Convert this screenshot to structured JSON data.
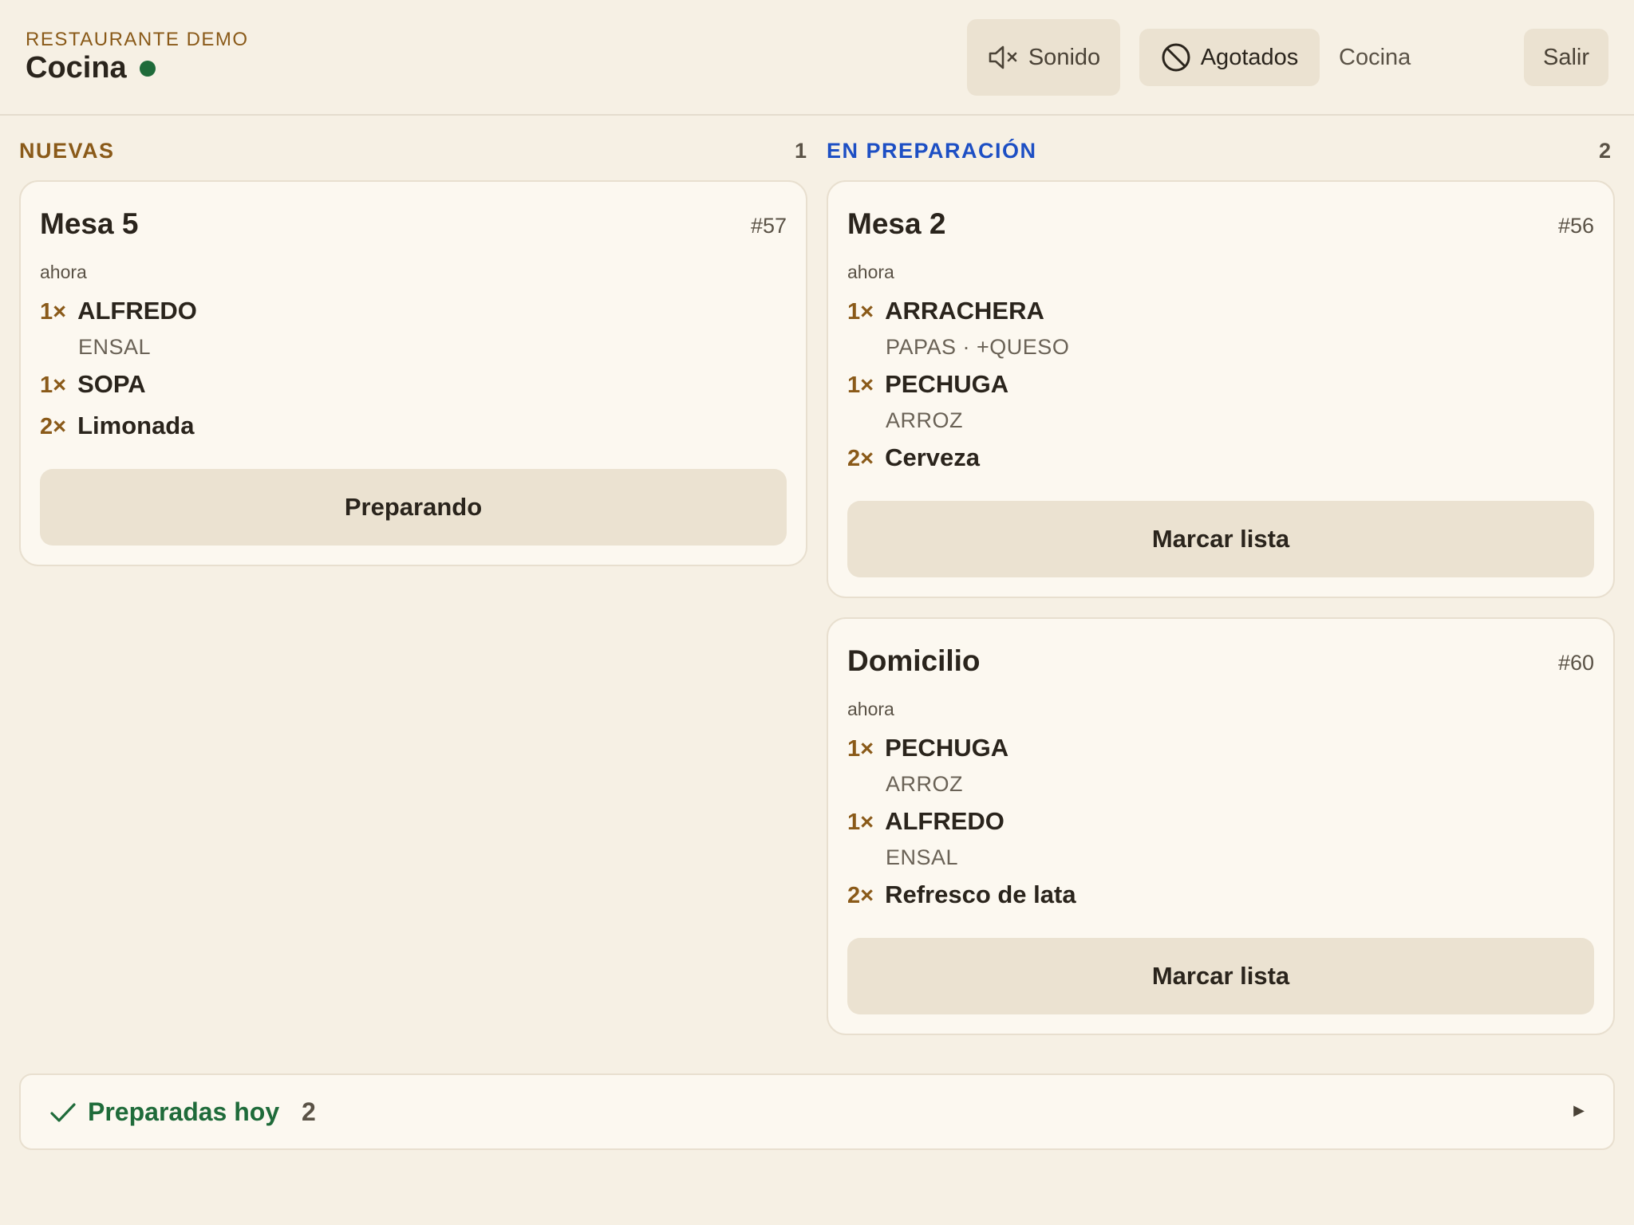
{
  "header": {
    "kicker": "RESTAURANTE DEMO",
    "title": "Cocina",
    "sound_label": "Sonido",
    "sold_out_label": "Agotados",
    "station": "Cocina",
    "exit_label": "Salir",
    "status_color": "#1f6b3a"
  },
  "columns": [
    {
      "title": "NUEVAS",
      "count": "1",
      "color": "#8a5a19",
      "cards": [
        {
          "title": "Mesa 5",
          "number": "#57",
          "time": "ahora",
          "lines": [
            {
              "qty": "1×",
              "item": "ALFREDO",
              "mods": "ENSAL"
            },
            {
              "qty": "1×",
              "item": "SOPA",
              "mods": ""
            },
            {
              "qty": "2×",
              "item": "Limonada",
              "mods": ""
            }
          ],
          "action": "Preparando"
        }
      ]
    },
    {
      "title": "EN PREPARACIÓN",
      "count": "2",
      "color": "#1d4fc4",
      "cards": [
        {
          "title": "Mesa 2",
          "number": "#56",
          "time": "ahora",
          "lines": [
            {
              "qty": "1×",
              "item": "ARRACHERA",
              "mods": "PAPAS · +QUESO"
            },
            {
              "qty": "1×",
              "item": "PECHUGA",
              "mods": "ARROZ"
            },
            {
              "qty": "2×",
              "item": "Cerveza",
              "mods": ""
            }
          ],
          "action": "Marcar lista"
        },
        {
          "title": "Domicilio",
          "number": "#60",
          "time": "ahora",
          "lines": [
            {
              "qty": "1×",
              "item": "PECHUGA",
              "mods": "ARROZ"
            },
            {
              "qty": "1×",
              "item": "ALFREDO",
              "mods": "ENSAL"
            },
            {
              "qty": "2×",
              "item": "Refresco de lata",
              "mods": ""
            }
          ],
          "action": "Marcar lista"
        }
      ]
    }
  ],
  "done_today": {
    "label": "Preparadas hoy",
    "count": "2"
  }
}
